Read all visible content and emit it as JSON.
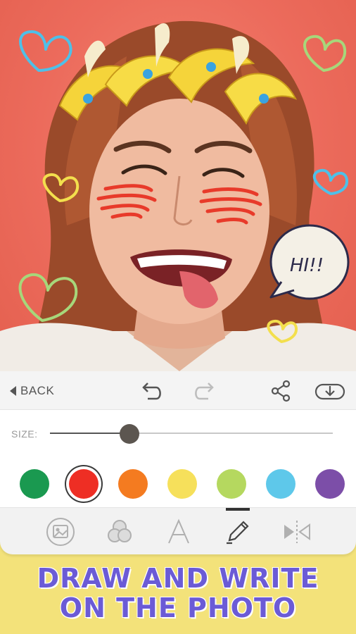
{
  "toolbar": {
    "back_label": "BACK",
    "icons": [
      "back-arrow-icon",
      "undo-icon",
      "redo-icon",
      "share-icon",
      "download-icon"
    ]
  },
  "sticker": {
    "speech_bubble_text": "HI!!"
  },
  "brush": {
    "size_label": "SIZE:",
    "size_value": 0.28
  },
  "colors": {
    "swatches": [
      "#1a9950",
      "#ee2e24",
      "#f47b20",
      "#f6e05b",
      "#b5d85f",
      "#5ec8ea",
      "#7c4ea8"
    ],
    "selected_index": 1,
    "accent": "#6b5bd6"
  },
  "modes": {
    "items": [
      "sticker-mode-icon",
      "filter-mode-icon",
      "text-mode-icon",
      "draw-mode-icon",
      "mirror-mode-icon"
    ],
    "active_index": 3
  },
  "caption": {
    "line1": "DRAW AND WRITE",
    "line2": "ON THE PHOTO"
  }
}
